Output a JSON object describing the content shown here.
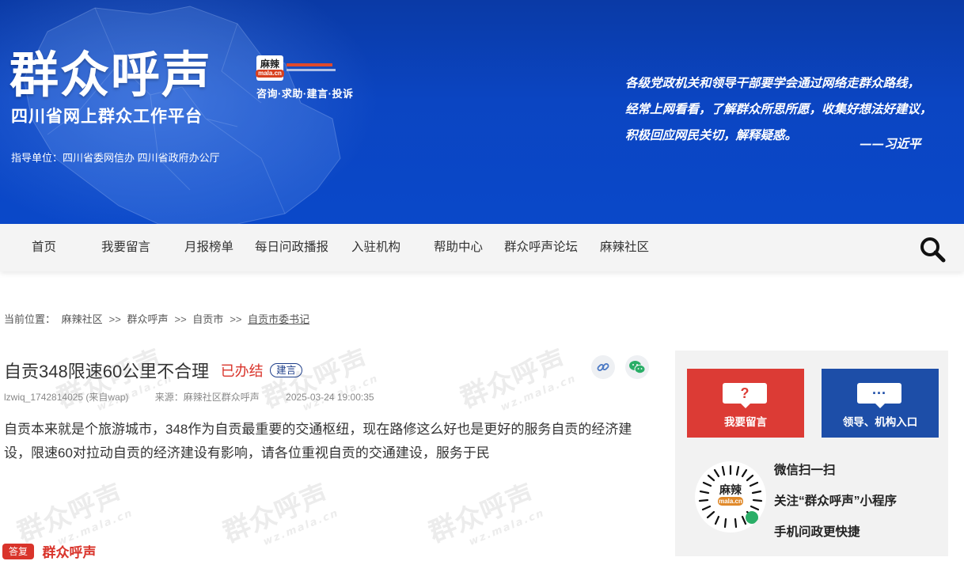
{
  "banner": {
    "title": "群众呼声",
    "subtitle": "四川省网上群众工作平台",
    "badge_top": "麻辣",
    "badge_bottom": "mala.cn",
    "slogan": "咨询·求助·建言·投诉",
    "guide": "指导单位：四川省委网信办 四川省政府办公厅",
    "quote_lines": [
      "各级党政机关和领导干部要学会通过网络走群众路线，",
      "经常上网看看，了解群众所思所愿，收集好想法好建议，",
      "积极回应网民关切，解释疑惑。"
    ],
    "quote_author": "——习近平"
  },
  "nav": {
    "items": [
      "首页",
      "我要留言",
      "月报榜单",
      "每日问政播报",
      "入驻机构",
      "帮助中心",
      "群众呼声论坛",
      "麻辣社区"
    ],
    "search_icon": "search-icon"
  },
  "breadcrumb": {
    "label": "当前位置：",
    "items": [
      "麻辣社区",
      "群众呼声",
      "自贡市",
      "自贡市委书记"
    ],
    "separator": ">>"
  },
  "watermark": {
    "text": "群众呼声",
    "sub": "wz.mala.cn"
  },
  "article": {
    "title": "自贡348限速60公里不合理",
    "status": "已办结",
    "tag": "建言",
    "author": "lzwiq_1742814025 (来自wap)",
    "source": "来源：麻辣社区群众呼声",
    "time": "2025-03-24 19:00:35",
    "body": "自贡本来就是个旅游城市，348作为自贡最重要的交通枢纽，现在路修这么好也是更好的服务自贡的经济建设，限速60对拉动自贡的经济建设有影响，请各位重视自贡的交通建设，服务于民"
  },
  "reply": {
    "badge": "答复",
    "name": "群众呼声"
  },
  "sidebar": {
    "leave_message": {
      "glyph": "?",
      "label": "我要留言",
      "color": "#dc3b35"
    },
    "leader_entry": {
      "glyph": "···",
      "label": "领导、机构入口",
      "color": "#1d4ea8"
    },
    "qr_lines": [
      "微信扫一扫",
      "关注“群众呼声”小程序",
      "手机问政更快捷"
    ],
    "qr_logo_top": "麻辣",
    "qr_logo_bottom": "mala.cn"
  },
  "colors": {
    "banner": "#0b45c2",
    "status_red": "#d9342b",
    "tag_blue": "#1f3f8a"
  }
}
